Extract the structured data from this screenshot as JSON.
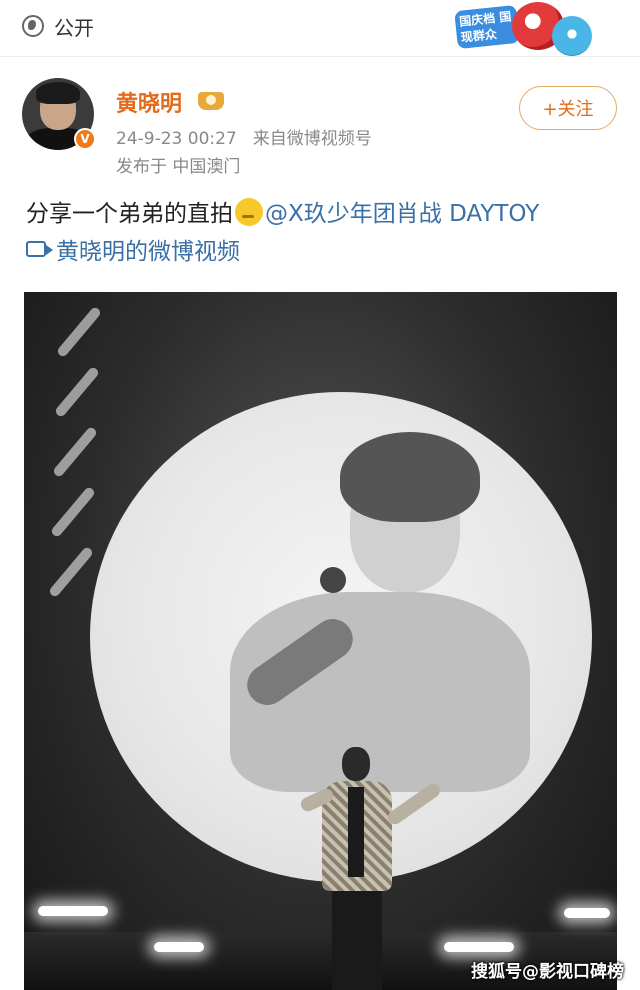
{
  "header": {
    "visibility_label": "公开",
    "event_badge_text": "国庆档 国现群众"
  },
  "post": {
    "author_name": "黄晓明",
    "verified_mark": "V",
    "timestamp": "24-9-23 00:27",
    "source": "来自微博视频号",
    "location": "发布于 中国澳门",
    "follow_label": "+关注",
    "text_main": "分享一个弟弟的直拍",
    "mention": "@X玖少年团肖战 DAYTOY",
    "video_link": "黄晓明的微博视频"
  },
  "watermark": "搜狐号@影视口碑榜",
  "colors": {
    "username": "#e26b1c",
    "link": "#3a6fa8",
    "follow_border": "#e6a96a"
  },
  "icons": [
    "globe-icon",
    "vip-crown-icon",
    "verified-badge-icon",
    "emoji-icon",
    "video-camera-icon"
  ]
}
